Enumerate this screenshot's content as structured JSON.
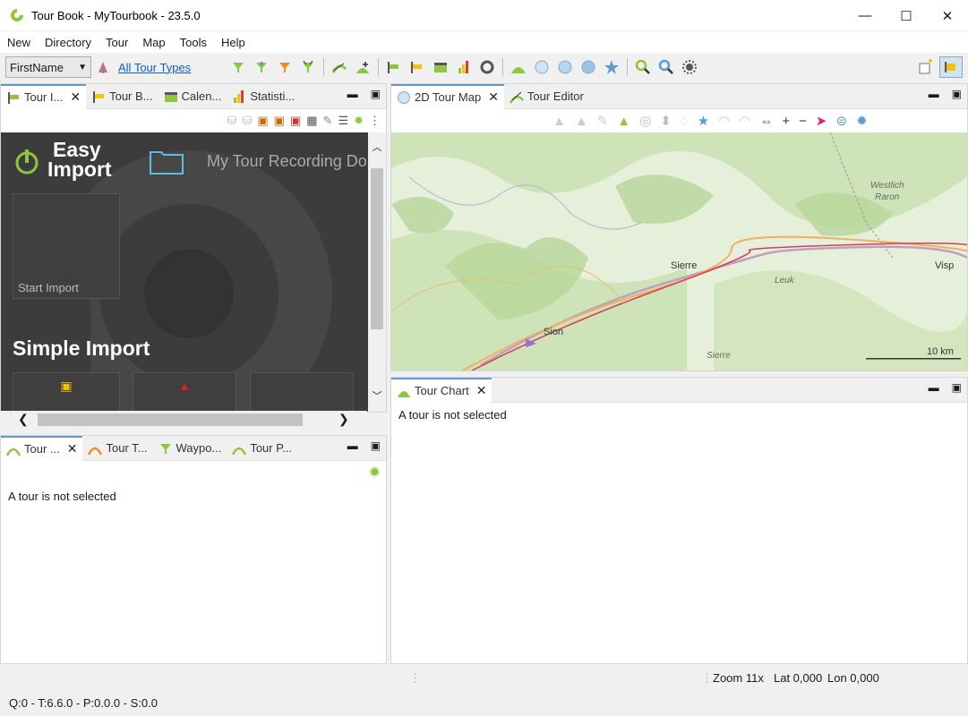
{
  "window": {
    "title": "Tour Book - MyTourbook - 23.5.0",
    "minimize": "—",
    "maximize": "☐",
    "close": "✕"
  },
  "menu": [
    "New",
    "Directory",
    "Tour",
    "Map",
    "Tools",
    "Help"
  ],
  "toolbar": {
    "select_value": "FirstName",
    "tour_types_link": "All Tour Types"
  },
  "left_top": {
    "tabs": [
      {
        "label": "Tour I..."
      },
      {
        "label": "Tour B..."
      },
      {
        "label": "Calen..."
      },
      {
        "label": "Statisti..."
      }
    ],
    "easy_import": {
      "title_line1": "Easy",
      "title_line2": "Import",
      "folder_text": "My Tour Recording Do",
      "start_import": "Start Import",
      "simple_import": "Simple Import"
    }
  },
  "left_bottom": {
    "tabs": [
      {
        "label": "Tour ..."
      },
      {
        "label": "Tour T..."
      },
      {
        "label": "Waypo..."
      },
      {
        "label": "Tour P..."
      }
    ],
    "message": "A tour is not selected"
  },
  "right_top": {
    "tabs": [
      {
        "label": "2D Tour Map"
      },
      {
        "label": "Tour Editor"
      }
    ],
    "map": {
      "labels": {
        "sierre": "Sierre",
        "sion": "Sion",
        "visp": "Visp",
        "leuk": "Leuk",
        "westlich": "Westlich",
        "raron": "Raron",
        "sierre2": "Sierre"
      },
      "scale": "10 km"
    }
  },
  "right_bottom": {
    "tabs": [
      {
        "label": "Tour Chart"
      }
    ],
    "message": "A tour is not selected"
  },
  "status": {
    "zoom": "Zoom 11x",
    "lat": "Lat 0,000",
    "lon": "Lon 0,000",
    "bottom": "Q:0 - T:6.6.0 - P:0.0.0 - S:0.0"
  },
  "colors": {
    "accent_green": "#8dc63f",
    "dark_panel": "#3c3c3c",
    "link": "#0b5fd0",
    "tab_accent": "#5b9bd5"
  }
}
